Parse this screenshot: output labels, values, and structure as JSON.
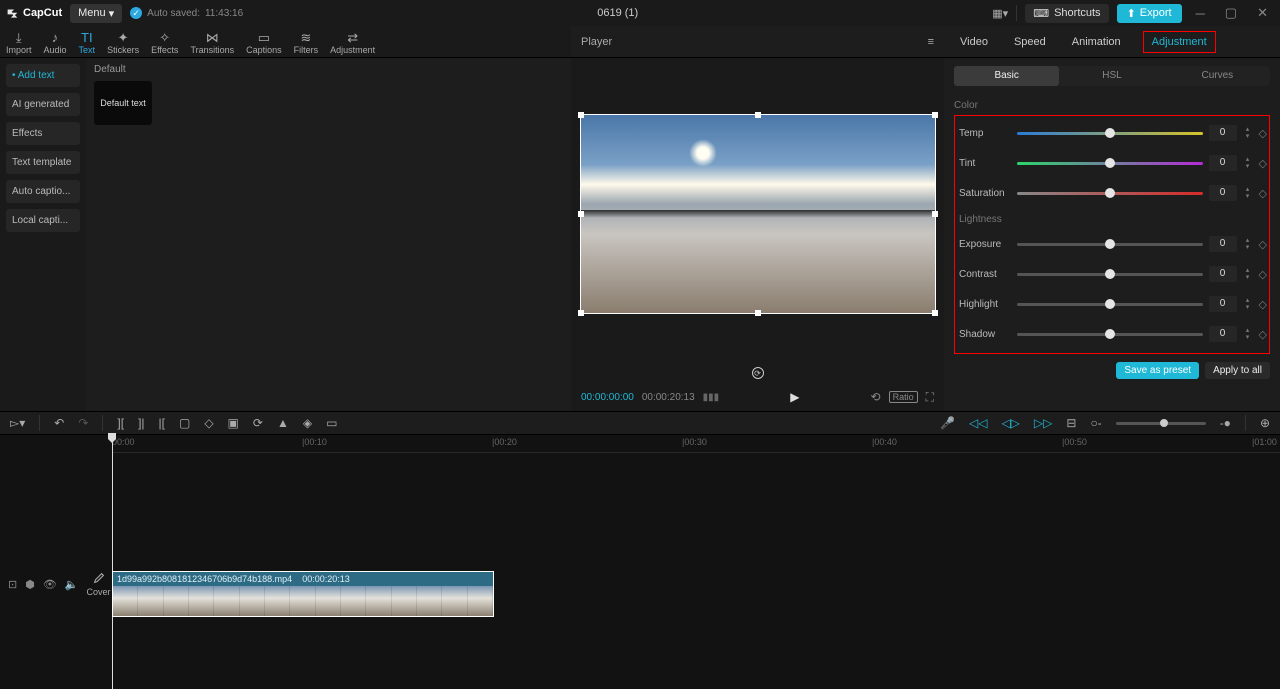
{
  "titlebar": {
    "app_name": "CapCut",
    "menu_label": "Menu",
    "autosave_label": "Auto saved:",
    "autosave_time": "11:43:16",
    "project_title": "0619 (1)",
    "shortcuts_label": "Shortcuts",
    "export_label": "Export"
  },
  "tools": [
    {
      "label": "Import",
      "icon": "⤓"
    },
    {
      "label": "Audio",
      "icon": "♪"
    },
    {
      "label": "Text",
      "icon": "TI",
      "active": true
    },
    {
      "label": "Stickers",
      "icon": "✦"
    },
    {
      "label": "Effects",
      "icon": "✧"
    },
    {
      "label": "Transitions",
      "icon": "⋈"
    },
    {
      "label": "Captions",
      "icon": "▭"
    },
    {
      "label": "Filters",
      "icon": "≋"
    },
    {
      "label": "Adjustment",
      "icon": "⇄"
    }
  ],
  "player_label": "Player",
  "sidebar": [
    {
      "label": "• Add text",
      "active": true
    },
    {
      "label": "AI generated"
    },
    {
      "label": "Effects"
    },
    {
      "label": "Text template"
    },
    {
      "label": "Auto captio..."
    },
    {
      "label": "Local capti..."
    }
  ],
  "browser": {
    "category": "Default",
    "thumb_label": "Default text"
  },
  "player": {
    "time_current": "00:00:00:00",
    "time_total": "00:00:20:13",
    "ratio_label": "Ratio"
  },
  "inspector_tabs": [
    {
      "label": "Video"
    },
    {
      "label": "Speed"
    },
    {
      "label": "Animation"
    },
    {
      "label": "Adjustment",
      "active": true
    }
  ],
  "basic_tabs": [
    {
      "label": "Basic",
      "active": true
    },
    {
      "label": "HSL"
    },
    {
      "label": "Curves"
    }
  ],
  "sections": {
    "color": "Color",
    "lightness": "Lightness"
  },
  "sliders": {
    "temp": {
      "name": "Temp",
      "value": 0,
      "grad": "linear-gradient(to right,#2b7bd6,#d6c22b)"
    },
    "tint": {
      "name": "Tint",
      "value": 0,
      "grad": "linear-gradient(to right,#2bd66a,#b52bd6)"
    },
    "saturation": {
      "name": "Saturation",
      "value": 0,
      "grad": "linear-gradient(to right,#888,#d62b2b)"
    },
    "exposure": {
      "name": "Exposure",
      "value": 0,
      "grad": "#555"
    },
    "contrast": {
      "name": "Contrast",
      "value": 0,
      "grad": "#555"
    },
    "highlight": {
      "name": "Highlight",
      "value": 0,
      "grad": "#555"
    },
    "shadow": {
      "name": "Shadow",
      "value": 0,
      "grad": "#555"
    }
  },
  "footer": {
    "save_preset": "Save as preset",
    "apply_all": "Apply to all"
  },
  "timeline": {
    "ruler": [
      "00:00",
      "|00:10",
      "|00:20",
      "|00:30",
      "|00:40",
      "|00:50",
      "|01:00"
    ],
    "cover": "Cover",
    "clip_name": "1d99a992b8081812346706b9d74b188.mp4",
    "clip_dur": "00:00:20:13"
  }
}
